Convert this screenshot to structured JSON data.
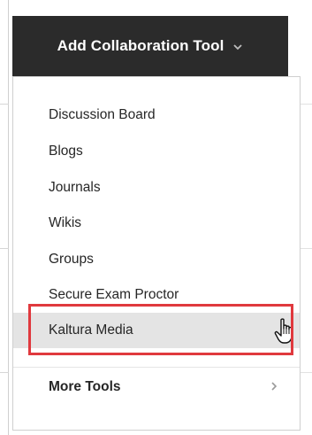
{
  "dropdown": {
    "label": "Add Collaboration Tool",
    "icon": "chevron-down-icon"
  },
  "menu": {
    "items": [
      {
        "label": "Discussion Board"
      },
      {
        "label": "Blogs"
      },
      {
        "label": "Journals"
      },
      {
        "label": "Wikis"
      },
      {
        "label": "Groups"
      },
      {
        "label": "Secure Exam Proctor"
      },
      {
        "label": "Kaltura Media",
        "state": "hovered",
        "highlighted": true
      }
    ],
    "more_tools": {
      "label": "More Tools",
      "icon": "chevron-right-icon"
    },
    "cursor_icon": "hand-pointer-icon"
  },
  "colors": {
    "button_bg": "#2b2b2b",
    "hover_bg": "#e4e4e4",
    "highlight_border": "#e0393e"
  }
}
